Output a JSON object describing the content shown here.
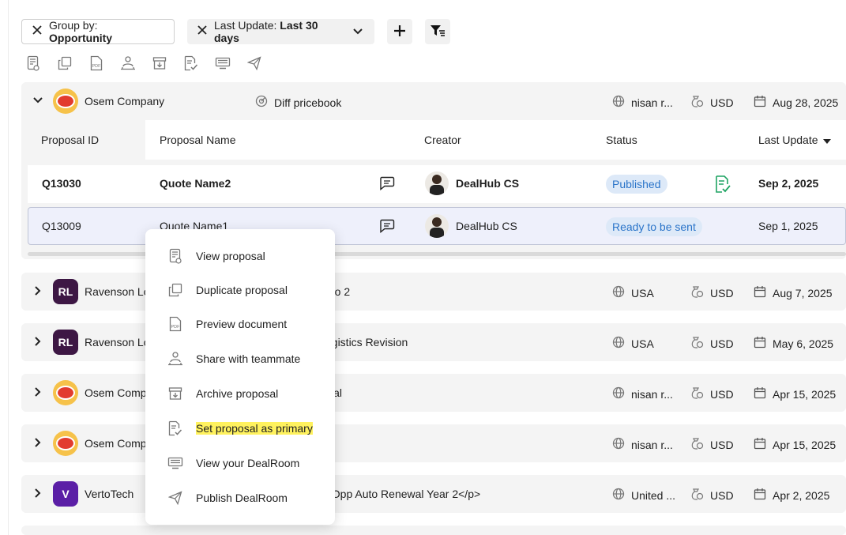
{
  "filters": {
    "group_by": {
      "label": "Group by:",
      "value": "Opportunity"
    },
    "last_update": {
      "label": "Last Update:",
      "value": "Last 30 days"
    }
  },
  "toolbar_icons": [
    "view-icon",
    "duplicate-icon",
    "pdf-icon",
    "share-icon",
    "archive-icon",
    "set-primary-icon",
    "dealroom-icon",
    "publish-icon"
  ],
  "groups": [
    {
      "name": "Osem Company",
      "opportunity": "Diff pricebook",
      "country": "nisan r...",
      "currency": "USD",
      "date": "Aug 28, 2025",
      "expanded": true,
      "avatar": "logo"
    },
    {
      "name": "Ravenson Lo",
      "opportunity": "mo 2",
      "country": "USA",
      "currency": "USD",
      "date": "Aug 7, 2025",
      "avatar_text": "RL"
    },
    {
      "name": "Ravenson Lo",
      "opportunity": "ogistics Revision",
      "country": "USA",
      "currency": "USD",
      "date": "May 6, 2025",
      "avatar_text": "RL"
    },
    {
      "name": "Osem Comp",
      "opportunity": "wal",
      "country": "nisan r...",
      "currency": "USD",
      "date": "Apr 15, 2025",
      "avatar": "logo"
    },
    {
      "name": "Osem Comp",
      "opportunity": "",
      "country": "nisan r...",
      "currency": "USD",
      "date": "Apr 15, 2025",
      "avatar": "logo"
    },
    {
      "name": "VertoTech",
      "opportunity": "t Opp Auto Renewal Year 2</p>",
      "country": "United ...",
      "currency": "USD",
      "date": "Apr 2, 2025",
      "avatar_text": "V"
    }
  ],
  "table": {
    "headers": {
      "id": "Proposal ID",
      "name": "Proposal Name",
      "creator": "Creator",
      "status": "Status",
      "last_update": "Last Update"
    },
    "rows": [
      {
        "id": "Q13030",
        "name": "Quote Name2",
        "creator": "DealHub CS",
        "status": "Published",
        "date": "Sep 2, 2025"
      },
      {
        "id": "Q13009",
        "name": "Quote Name1",
        "creator": "DealHub CS",
        "status": "Ready to be sent",
        "date": "Sep 1, 2025"
      }
    ]
  },
  "menu": [
    {
      "label": "View proposal",
      "icon": "view-icon"
    },
    {
      "label": "Duplicate proposal",
      "icon": "duplicate-icon"
    },
    {
      "label": "Preview document",
      "icon": "pdf-icon"
    },
    {
      "label": "Share with teammate",
      "icon": "share-icon"
    },
    {
      "label": "Archive proposal",
      "icon": "archive-icon"
    },
    {
      "label": "Set proposal as primary",
      "icon": "set-primary-icon",
      "highlighted": true
    },
    {
      "label": "View your DealRoom",
      "icon": "dealroom-icon"
    },
    {
      "label": "Publish DealRoom",
      "icon": "publish-icon"
    }
  ],
  "colors": {
    "accent_green": "#1fa463",
    "badge_blue": "#2a74c9",
    "highlight": "#fff25e"
  }
}
